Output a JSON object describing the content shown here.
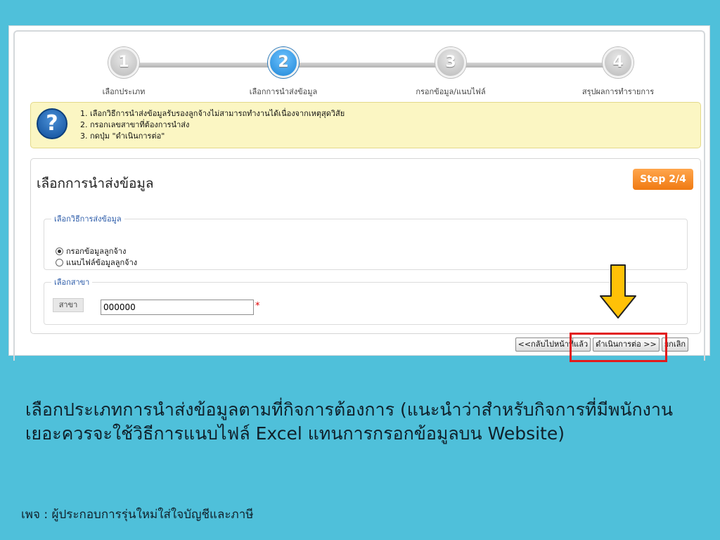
{
  "stepper": {
    "steps": [
      {
        "number": "1",
        "label": "เลือกประเภท"
      },
      {
        "number": "2",
        "label": "เลือกการนำส่งข้อมูล"
      },
      {
        "number": "3",
        "label": "กรอกข้อมูล/แนบไฟล์"
      },
      {
        "number": "4",
        "label": "สรุปผลการทำรายการ"
      }
    ],
    "active_step": 2
  },
  "info": {
    "icon": "question-icon",
    "icon_text": "?",
    "lines": [
      "1. เลือกวิธีการนำส่งข้อมูลรับรองลูกจ้างไม่สามารถทำงานได้เนื่องจากเหตุสุดวิสัย",
      "2. กรอกเลขสาขาที่ต้องการนำส่ง",
      "3. กดปุ่ม \"ดำเนินการต่อ\""
    ]
  },
  "panel": {
    "title": "เลือกการนำส่งข้อมูล",
    "badge": "Step 2/4",
    "method": {
      "legend": "เลือกวิธีการส่งข้อมูล",
      "options": [
        "กรอกข้อมูลลูกจ้าง",
        "แนบไฟล์ข้อมูลลูกจ้าง"
      ],
      "selected_index": 0
    },
    "branch": {
      "legend": "เลือกสาขา",
      "label": "สาขา",
      "value": "000000",
      "required_mark": "*"
    }
  },
  "buttons": {
    "back": "<<กลับไปหน้าที่แล้ว",
    "next": "ดำเนินการต่อ >>",
    "cancel": "ยกเลิก"
  },
  "colors": {
    "background": "#4fc0da",
    "accent_blue": "#1f86d6",
    "badge_orange": "#f07a12",
    "arrow_yellow": "#ffc107",
    "highlight_red": "#e21b1b"
  },
  "caption": "เลือกประเภทการนำส่งข้อมูลตามที่กิจการต้องการ (แนะนำว่าสำหรับกิจการที่มีพนักงานเยอะควรจะใช้วิธีการแนบไฟล์ Excel แทนการกรอกข้อมูลบน Website)",
  "footer": "เพจ : ผู้ประกอบการรุ่นใหม่ใส่ใจบัญชีและภาษี"
}
